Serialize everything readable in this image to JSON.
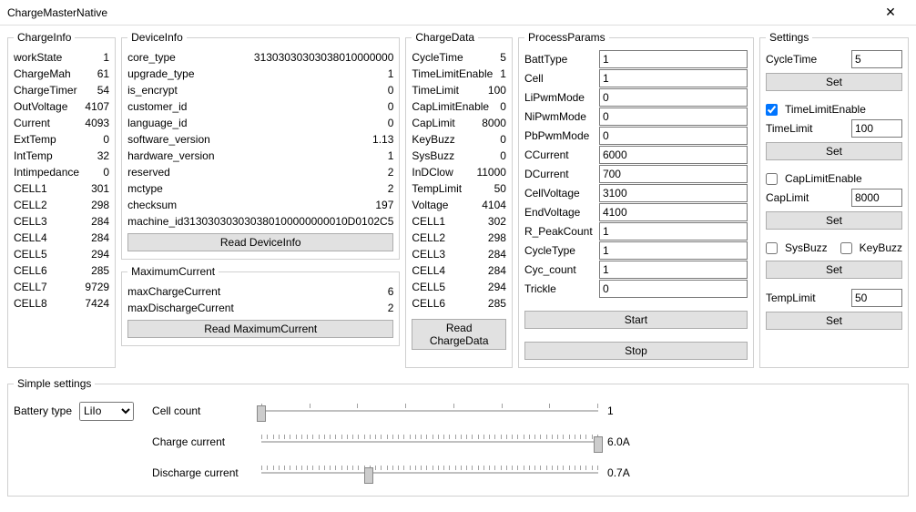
{
  "window": {
    "title": "ChargeMasterNative",
    "close": "✕"
  },
  "chargeInfo": {
    "legend": "ChargeInfo",
    "rows": [
      {
        "k": "workState",
        "v": "1"
      },
      {
        "k": "ChargeMah",
        "v": "61"
      },
      {
        "k": "ChargeTimer",
        "v": "54"
      },
      {
        "k": "OutVoltage",
        "v": "4107"
      },
      {
        "k": "Current",
        "v": "4093"
      },
      {
        "k": "ExtTemp",
        "v": "0"
      },
      {
        "k": "IntTemp",
        "v": "32"
      },
      {
        "k": "Intimpedance",
        "v": "0"
      },
      {
        "k": "CELL1",
        "v": "301"
      },
      {
        "k": "CELL2",
        "v": "298"
      },
      {
        "k": "CELL3",
        "v": "284"
      },
      {
        "k": "CELL4",
        "v": "284"
      },
      {
        "k": "CELL5",
        "v": "294"
      },
      {
        "k": "CELL6",
        "v": "285"
      },
      {
        "k": "CELL7",
        "v": "9729"
      },
      {
        "k": "CELL8",
        "v": "7424"
      }
    ]
  },
  "deviceInfo": {
    "legend": "DeviceInfo",
    "rows": [
      {
        "k": "core_type",
        "v": "31303030303038010000000"
      },
      {
        "k": "upgrade_type",
        "v": "1"
      },
      {
        "k": "is_encrypt",
        "v": "0"
      },
      {
        "k": "customer_id",
        "v": "0"
      },
      {
        "k": "language_id",
        "v": "0"
      },
      {
        "k": "software_version",
        "v": "1.13"
      },
      {
        "k": "hardware_version",
        "v": "1"
      },
      {
        "k": "reserved",
        "v": "2"
      },
      {
        "k": "mctype",
        "v": "2"
      },
      {
        "k": "checksum",
        "v": "197"
      },
      {
        "k": "machine_id",
        "v": "313030303030380100000000010D0102C5"
      }
    ],
    "button": "Read DeviceInfo"
  },
  "maxCurrent": {
    "legend": "MaximumCurrent",
    "rows": [
      {
        "k": "maxChargeCurrent",
        "v": "6"
      },
      {
        "k": "maxDischargeCurrent",
        "v": "2"
      }
    ],
    "button": "Read MaximumCurrent"
  },
  "chargeData": {
    "legend": "ChargeData",
    "rows": [
      {
        "k": "CycleTime",
        "v": "5"
      },
      {
        "k": "TimeLimitEnable",
        "v": "1"
      },
      {
        "k": "TimeLimit",
        "v": "100"
      },
      {
        "k": "CapLimitEnable",
        "v": "0"
      },
      {
        "k": "CapLimit",
        "v": "8000"
      },
      {
        "k": "KeyBuzz",
        "v": "0"
      },
      {
        "k": "SysBuzz",
        "v": "0"
      },
      {
        "k": "InDClow",
        "v": "11000"
      },
      {
        "k": "TempLimit",
        "v": "50"
      },
      {
        "k": "Voltage",
        "v": "4104"
      },
      {
        "k": "CELL1",
        "v": "302"
      },
      {
        "k": "CELL2",
        "v": "298"
      },
      {
        "k": "CELL3",
        "v": "284"
      },
      {
        "k": "CELL4",
        "v": "284"
      },
      {
        "k": "CELL5",
        "v": "294"
      },
      {
        "k": "CELL6",
        "v": "285"
      }
    ],
    "button": "Read ChargeData"
  },
  "processParams": {
    "legend": "ProcessParams",
    "rows": [
      {
        "k": "BattType",
        "v": "1"
      },
      {
        "k": "Cell",
        "v": "1"
      },
      {
        "k": "LiPwmMode",
        "v": "0"
      },
      {
        "k": "NiPwmMode",
        "v": "0"
      },
      {
        "k": "PbPwmMode",
        "v": "0"
      },
      {
        "k": "CCurrent",
        "v": "6000"
      },
      {
        "k": "DCurrent",
        "v": "700"
      },
      {
        "k": "CellVoltage",
        "v": "3100"
      },
      {
        "k": "EndVoltage",
        "v": "4100"
      },
      {
        "k": "R_PeakCount",
        "v": "1"
      },
      {
        "k": "CycleType",
        "v": "1"
      },
      {
        "k": "Cyc_count",
        "v": "1"
      },
      {
        "k": "Trickle",
        "v": "0"
      }
    ],
    "start": "Start",
    "stop": "Stop"
  },
  "settings": {
    "legend": "Settings",
    "cycleTimeLabel": "CycleTime",
    "cycleTime": "5",
    "set": "Set",
    "timeLimitEnable": "TimeLimitEnable",
    "timeLimitEnableChecked": true,
    "timeLimitLabel": "TimeLimit",
    "timeLimit": "100",
    "capLimitEnable": "CapLimitEnable",
    "capLimitEnableChecked": false,
    "capLimitLabel": "CapLimit",
    "capLimit": "8000",
    "sysBuzz": "SysBuzz",
    "sysBuzzChecked": false,
    "keyBuzz": "KeyBuzz",
    "keyBuzzChecked": false,
    "tempLimitLabel": "TempLimit",
    "tempLimit": "50"
  },
  "simple": {
    "legend": "Simple settings",
    "battTypeLabel": "Battery type",
    "battType": "LiIo",
    "cellCountLabel": "Cell count",
    "cellCount": "1",
    "chargeCurrentLabel": "Charge current",
    "chargeCurrent": "6.0A",
    "dischargeCurrentLabel": "Discharge current",
    "dischargeCurrent": "0.7A"
  }
}
